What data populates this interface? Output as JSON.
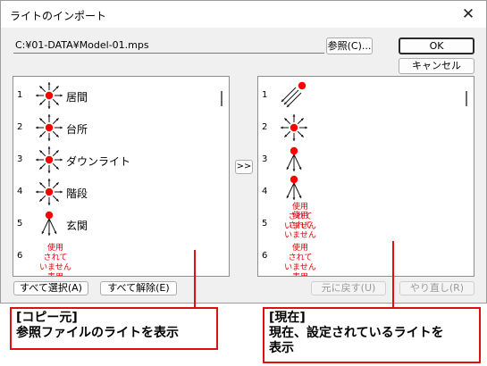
{
  "dialog": {
    "title": "ライトのインポート",
    "file_path": "C:¥01-DATA¥Model-01.mps",
    "browse_label": "参照(C)...",
    "ok_label": "OK",
    "cancel_label": "キャンセル",
    "transfer_label": ">>",
    "select_all_label": "すべて選択(A)",
    "deselect_all_label": "すべて解除(E)",
    "undo_label": "元に戻す(U)",
    "redo_label": "やり直し(R)",
    "unused_text": [
      "使用",
      "されて",
      "いません"
    ],
    "unused_partial": "表用"
  },
  "source_list": [
    {
      "num": "1",
      "icon": "omni-light-icon",
      "label": "居間"
    },
    {
      "num": "2",
      "icon": "omni-light-icon",
      "label": "台所"
    },
    {
      "num": "3",
      "icon": "omni-light-icon",
      "label": "ダウンライト"
    },
    {
      "num": "4",
      "icon": "omni-light-icon",
      "label": "階段"
    },
    {
      "num": "5",
      "icon": "spot-light-icon",
      "label": "玄関"
    },
    {
      "num": "6",
      "icon": "unused",
      "label": ""
    }
  ],
  "current_list": [
    {
      "num": "1",
      "icon": "directional-light-icon"
    },
    {
      "num": "2",
      "icon": "omni-light-icon"
    },
    {
      "num": "3",
      "icon": "spot-light-icon"
    },
    {
      "num": "4",
      "icon": "spot-light-unused"
    },
    {
      "num": "5",
      "icon": "unused"
    },
    {
      "num": "6",
      "icon": "unused"
    }
  ],
  "annotations": {
    "source_title": "[コピー元]",
    "source_desc": "参照ファイルのライトを表示",
    "current_title": "[現在]",
    "current_desc_1": "現在、設定されているライトを",
    "current_desc_2": "表示"
  },
  "colors": {
    "accent_red": "#e01010",
    "unused_text": "#e00000"
  }
}
